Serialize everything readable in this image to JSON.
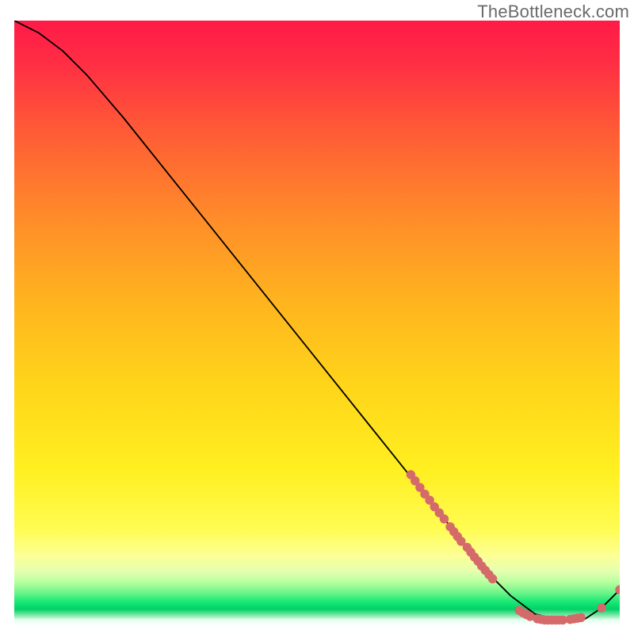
{
  "watermark": "TheBottleneck.com",
  "chart_data": {
    "type": "line",
    "title": "",
    "xlabel": "",
    "ylabel": "",
    "xlim": [
      0,
      100
    ],
    "ylim": [
      0,
      100
    ],
    "grid": false,
    "legend": false,
    "background_gradient": {
      "top_color": "#ff1a47",
      "mid_upper_color": "#ff7a2e",
      "mid_color": "#ffd31a",
      "mid_lower_color": "#fff02a",
      "pale_yellow": "#fffca8",
      "pale_green_top": "#c8ffb0",
      "green_band": "#00e873",
      "deep_green": "#00c560",
      "bottom_white": "#ffffff"
    },
    "series": [
      {
        "name": "bottleneck-curve",
        "color": "#000000",
        "x": [
          0,
          4,
          8,
          12,
          18,
          26,
          34,
          42,
          50,
          58,
          66,
          70,
          74,
          78,
          82,
          86,
          90,
          94,
          97,
          100
        ],
        "y": [
          100,
          98,
          95,
          91,
          84,
          74,
          64,
          54,
          44,
          34,
          24,
          19,
          14,
          9,
          5,
          2,
          1,
          1,
          3,
          6
        ]
      }
    ],
    "markers": {
      "name": "highlight-points",
      "color": "#d46a6a",
      "segments": [
        {
          "x": [
            65.5,
            66.2,
            67.0,
            67.8,
            68.6,
            69.4,
            70.2,
            71.0
          ],
          "y": [
            25.0,
            24.0,
            22.9,
            21.8,
            20.8,
            19.7,
            18.7,
            17.7
          ]
        },
        {
          "x": [
            72.0,
            72.6,
            73.2,
            73.8
          ],
          "y": [
            16.4,
            15.6,
            14.8,
            14.0
          ]
        },
        {
          "x": [
            74.8,
            75.4,
            76.0,
            76.6,
            77.2,
            77.8,
            78.4,
            79.0
          ],
          "y": [
            13.0,
            12.2,
            11.4,
            10.7,
            9.9,
            9.2,
            8.5,
            7.8
          ]
        },
        {
          "x": [
            83.4,
            84.0,
            84.6,
            85.2,
            86.4,
            87.0,
            87.6,
            88.2,
            88.8,
            89.4,
            90.0,
            90.6,
            91.8,
            92.4,
            93.0,
            93.6
          ],
          "y": [
            2.6,
            2.2,
            1.9,
            1.6,
            1.2,
            1.1,
            1.0,
            1.0,
            1.0,
            1.0,
            1.0,
            1.0,
            1.1,
            1.2,
            1.3,
            1.4
          ]
        },
        {
          "x": [
            97.0
          ],
          "y": [
            3.0
          ]
        },
        {
          "x": [
            100.0
          ],
          "y": [
            6.0
          ]
        }
      ]
    }
  }
}
